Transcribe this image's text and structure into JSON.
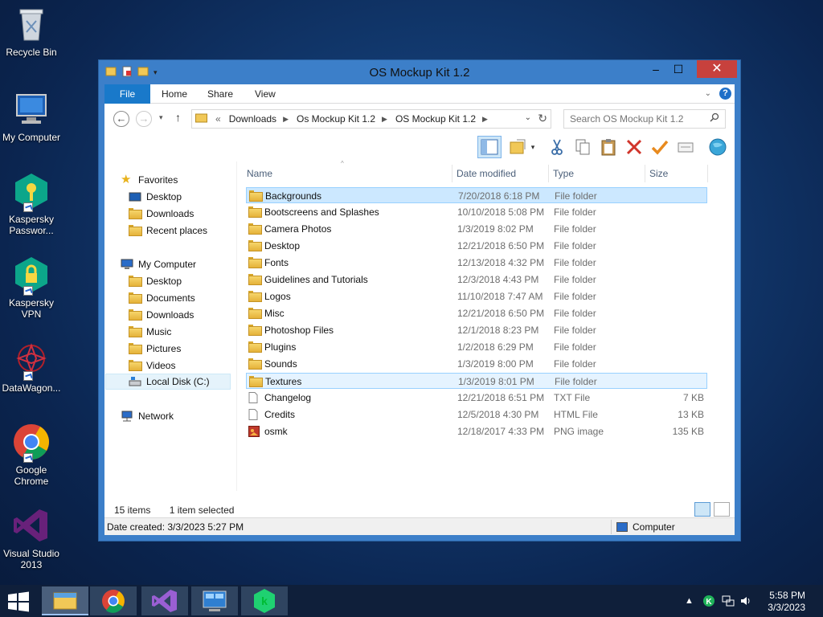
{
  "desktop": {
    "icons": [
      {
        "label": "Recycle Bin"
      },
      {
        "label": "My Computer"
      },
      {
        "label": "Kaspersky Passwor..."
      },
      {
        "label": "Kaspersky VPN"
      },
      {
        "label": "DataWagon..."
      },
      {
        "label": "Google Chrome"
      },
      {
        "label": "Visual Studio 2013"
      }
    ]
  },
  "window": {
    "title": "OS Mockup Kit 1.2",
    "controls": {
      "minimize": "‒",
      "maximize": "☐",
      "close": "✕"
    },
    "ribbon_tabs": [
      "File",
      "Home",
      "Share",
      "View"
    ],
    "address": {
      "prefix": "«",
      "segments": [
        "Downloads",
        "Os Mockup Kit 1.2",
        "OS Mockup Kit 1.2"
      ]
    },
    "search_placeholder": "Search OS Mockup Kit 1.2",
    "navpane": {
      "favorites": "Favorites",
      "favorites_items": [
        "Desktop",
        "Downloads",
        "Recent places"
      ],
      "computer": "My Computer",
      "computer_items": [
        "Desktop",
        "Documents",
        "Downloads",
        "Music",
        "Pictures",
        "Videos",
        "Local Disk (C:)"
      ],
      "network": "Network"
    },
    "columns": {
      "name": "Name",
      "date": "Date modified",
      "type": "Type",
      "size": "Size"
    },
    "files": [
      {
        "name": "Backgrounds",
        "date": "7/20/2018 6:18 PM",
        "type": "File folder",
        "size": "",
        "kind": "folder"
      },
      {
        "name": "Bootscreens and Splashes",
        "date": "10/10/2018 5:08 PM",
        "type": "File folder",
        "size": "",
        "kind": "folder"
      },
      {
        "name": "Camera Photos",
        "date": "1/3/2019 8:02 PM",
        "type": "File folder",
        "size": "",
        "kind": "folder"
      },
      {
        "name": "Desktop",
        "date": "12/21/2018 6:50 PM",
        "type": "File folder",
        "size": "",
        "kind": "folder"
      },
      {
        "name": "Fonts",
        "date": "12/13/2018 4:32 PM",
        "type": "File folder",
        "size": "",
        "kind": "folder"
      },
      {
        "name": "Guidelines and Tutorials",
        "date": "12/3/2018 4:43 PM",
        "type": "File folder",
        "size": "",
        "kind": "folder"
      },
      {
        "name": "Logos",
        "date": "11/10/2018 7:47 AM",
        "type": "File folder",
        "size": "",
        "kind": "folder"
      },
      {
        "name": "Misc",
        "date": "12/21/2018 6:50 PM",
        "type": "File folder",
        "size": "",
        "kind": "folder"
      },
      {
        "name": "Photoshop Files",
        "date": "12/1/2018 8:23 PM",
        "type": "File folder",
        "size": "",
        "kind": "folder"
      },
      {
        "name": "Plugins",
        "date": "1/2/2018 6:29 PM",
        "type": "File folder",
        "size": "",
        "kind": "folder"
      },
      {
        "name": "Sounds",
        "date": "1/3/2019 8:00 PM",
        "type": "File folder",
        "size": "",
        "kind": "folder"
      },
      {
        "name": "Textures",
        "date": "1/3/2019 8:01 PM",
        "type": "File folder",
        "size": "",
        "kind": "folder"
      },
      {
        "name": "Changelog",
        "date": "12/21/2018 6:51 PM",
        "type": "TXT File",
        "size": "7 KB",
        "kind": "txt"
      },
      {
        "name": "Credits",
        "date": "12/5/2018 4:30 PM",
        "type": "HTML File",
        "size": "13 KB",
        "kind": "html"
      },
      {
        "name": "osmk",
        "date": "12/18/2017 4:33 PM",
        "type": "PNG image",
        "size": "135 KB",
        "kind": "png"
      }
    ],
    "status": {
      "count": "15 items",
      "selected": "1 item selected"
    },
    "details": {
      "left": "Date created: 3/3/2023 5:27 PM",
      "right": "Computer"
    }
  },
  "taskbar": {
    "time": "5:58 PM",
    "date": "3/3/2023"
  },
  "colors": {
    "accent": "#1979ca",
    "close": "#c7413d",
    "selection": "#cce8ff"
  }
}
